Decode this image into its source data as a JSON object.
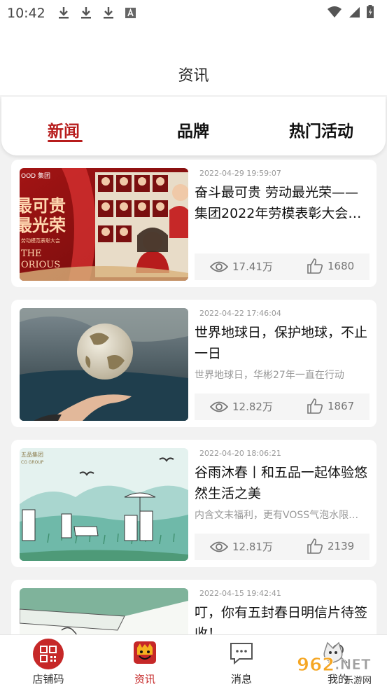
{
  "status": {
    "time": "10:42"
  },
  "header": {
    "title": "资讯"
  },
  "tabs": [
    {
      "label": "新闻",
      "active": true
    },
    {
      "label": "品牌",
      "active": false
    },
    {
      "label": "热门活动",
      "active": false
    }
  ],
  "articles": [
    {
      "date": "2022-04-29 19:59:07",
      "title": "奋斗最可贵 劳动最光荣——集团2022年劳模表彰大会…",
      "subtitle": "",
      "views": "17.41万",
      "likes": "1680",
      "image": "award-ceremony-collage"
    },
    {
      "date": "2022-04-22 17:46:04",
      "title": "世界地球日，保护地球，不止一日",
      "subtitle": "世界地球日，华彬27年一直在行动",
      "views": "12.82万",
      "likes": "1867",
      "image": "globe-in-hand"
    },
    {
      "date": "2022-04-20 18:06:21",
      "title": "谷雨沐春丨和五品一起体验悠然生活之美",
      "subtitle": "内含文末福利，更有VOSS气泡水限…",
      "views": "12.81万",
      "likes": "2139",
      "image": "spring-rain-illustration"
    },
    {
      "date": "2022-04-15 19:42:41",
      "title": "叮，你有五封春日明信片待签收！",
      "subtitle": "",
      "views": "",
      "likes": "",
      "image": "postcard-illustration"
    }
  ],
  "thumb_text": {
    "a1_top": "OOD\n集团",
    "a1_big1": "最可贵",
    "a1_big2": "最光荣",
    "a1_small": "劳动模范表彰大会",
    "a1_en1": "THE",
    "a1_en2": "ORIOUS",
    "a3_brand1": "五品集团",
    "a3_brand2": "CG GROUP"
  },
  "bottom_nav": [
    {
      "label": "店铺码",
      "icon": "qr-code-icon",
      "active": false
    },
    {
      "label": "资讯",
      "icon": "news-mascot-icon",
      "active": true
    },
    {
      "label": "消息",
      "icon": "message-bubble-icon",
      "active": false
    },
    {
      "label": "我的",
      "icon": "profile-icon",
      "active": false
    }
  ],
  "watermark": {
    "text1": "962",
    "text2": ".NET",
    "text3": "乐游网"
  },
  "colors": {
    "accent": "#b71c1c",
    "background": "#f2f2f2"
  }
}
